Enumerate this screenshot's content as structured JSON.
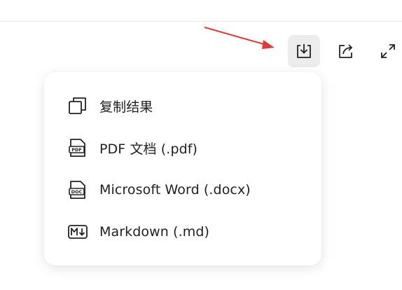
{
  "toolbar": {
    "buttons": [
      {
        "name": "download",
        "icon": "download-icon",
        "active": true
      },
      {
        "name": "share",
        "icon": "share-icon",
        "active": false
      },
      {
        "name": "expand",
        "icon": "expand-icon",
        "active": false
      }
    ]
  },
  "annotation": {
    "color": "#e53935",
    "icon": "red-arrow-pointer"
  },
  "menu": {
    "items": [
      {
        "icon": "copy-icon",
        "label": "复制结果"
      },
      {
        "icon": "pdf-file-icon",
        "label": "PDF 文档 (.pdf)"
      },
      {
        "icon": "doc-file-icon",
        "label": "Microsoft Word (.docx)"
      },
      {
        "icon": "markdown-icon",
        "label": "Markdown (.md)"
      }
    ]
  }
}
